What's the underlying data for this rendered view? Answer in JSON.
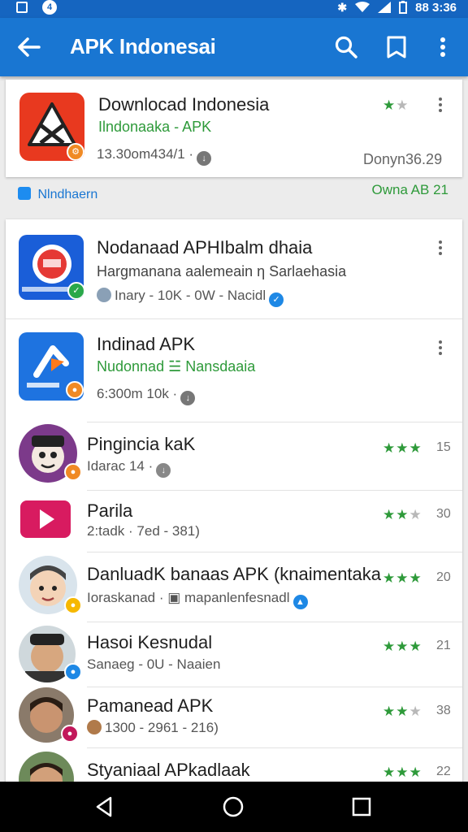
{
  "status_bar": {
    "time": "88 3:36"
  },
  "app_bar": {
    "title": "APK Indonesai",
    "back_icon": "back-arrow-icon",
    "search_icon": "search-icon",
    "bookmark_icon": "bookmark-icon",
    "menu_icon": "more-vert-icon"
  },
  "featured": {
    "title": "Downlocad Indonesia",
    "subtitle": "Ilndonaaka - APK",
    "meta": "13.30om434/1 ·",
    "date": "Donyn36.29"
  },
  "section_bar": {
    "label": "Nlndhaern",
    "right": "Owna AB  21"
  },
  "list_a": [
    {
      "title": "Nodanaad APHIbalm dhaia",
      "subtitle": "Hargmanana aalemeain η Sarlaehasia",
      "meta": "Inary - 10K - 0W - Nacidl"
    },
    {
      "title": "Indinad APK",
      "subtitle": "Nudonnad ☱ Nansdaaia",
      "meta": "6:300m 10k ·"
    }
  ],
  "list_b": [
    {
      "title": "Pingincia kaK",
      "meta": "Idarac 14 ·",
      "rating": "15",
      "stars_on": 3
    },
    {
      "title": "Parila",
      "meta": "2:tadk · 7ed - 381)",
      "rating": "30",
      "stars_on": 2
    },
    {
      "title": "DanluadK banaas APK (knaimentaka",
      "meta": "Ioraskanad · ▣ mapanlenfesnadl",
      "rating": "20",
      "stars_on": 3
    },
    {
      "title": "Hasoi Kesnudal",
      "meta": "Sanaeg - 0U - Naaien",
      "rating": "21",
      "stars_on": 3
    },
    {
      "title": "Pamanead APK",
      "meta": "1300 - 2961 - 216)",
      "rating": "38",
      "stars_on": 2
    },
    {
      "title": "Styaniaal APkadlaak",
      "meta": "",
      "rating": "22",
      "stars_on": 3
    }
  ],
  "colors": {
    "app_bar": "#1976d2",
    "status_bar": "#1565c0",
    "green": "#2e9a3a"
  }
}
